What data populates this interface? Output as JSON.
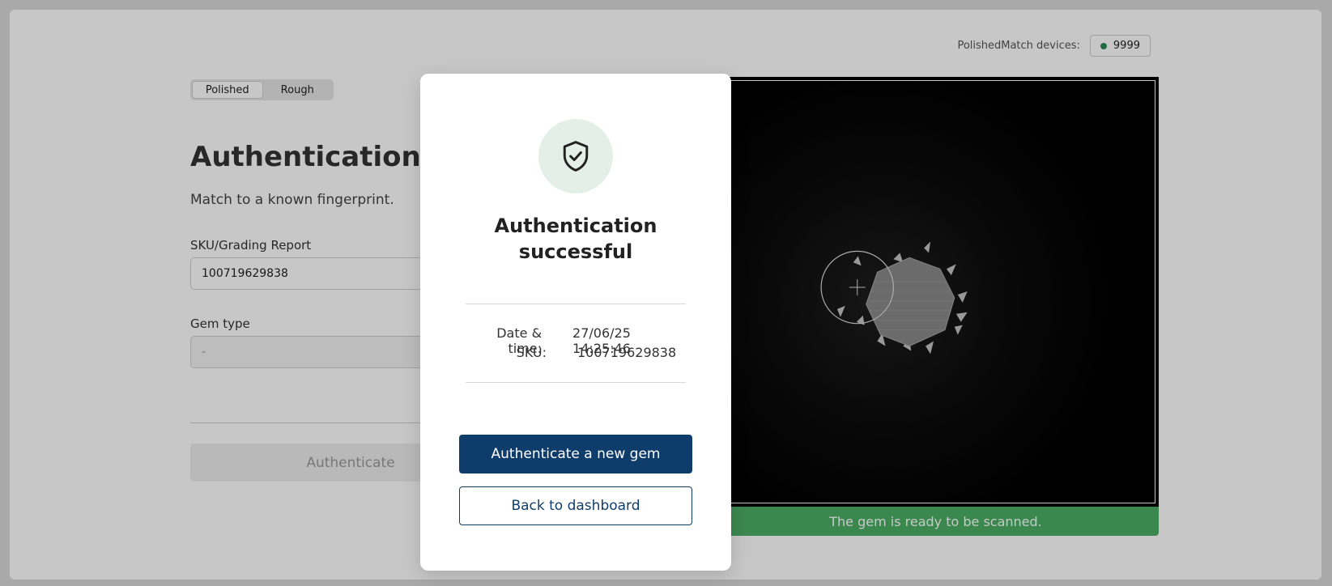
{
  "devices": {
    "label": "PolishedMatch devices:",
    "count": "9999",
    "status_color": "#2e8b57"
  },
  "mode_toggle": {
    "options": [
      "Polished",
      "Rough"
    ],
    "selected": "Polished"
  },
  "page": {
    "title": "Authentication",
    "subtitle": "Match to a known fingerprint."
  },
  "form": {
    "sku_label": "SKU/Grading Report",
    "sku_value": "100719629838",
    "gem_type_label": "Gem type",
    "gem_type_value": "-",
    "submit_label": "Authenticate"
  },
  "camera": {
    "status_text": "The gem is ready to be scanned.",
    "status_color": "#4caf66"
  },
  "modal": {
    "icon": "shield-check-icon",
    "title": "Authentication successful",
    "rows": [
      {
        "key": "Date & time:",
        "value": "27/06/25 14:25:46"
      },
      {
        "key": "SKU:",
        "value": "100719629838"
      }
    ],
    "primary_label": "Authenticate a new gem",
    "secondary_label": "Back to dashboard",
    "accent_color": "#0f3d6b"
  }
}
